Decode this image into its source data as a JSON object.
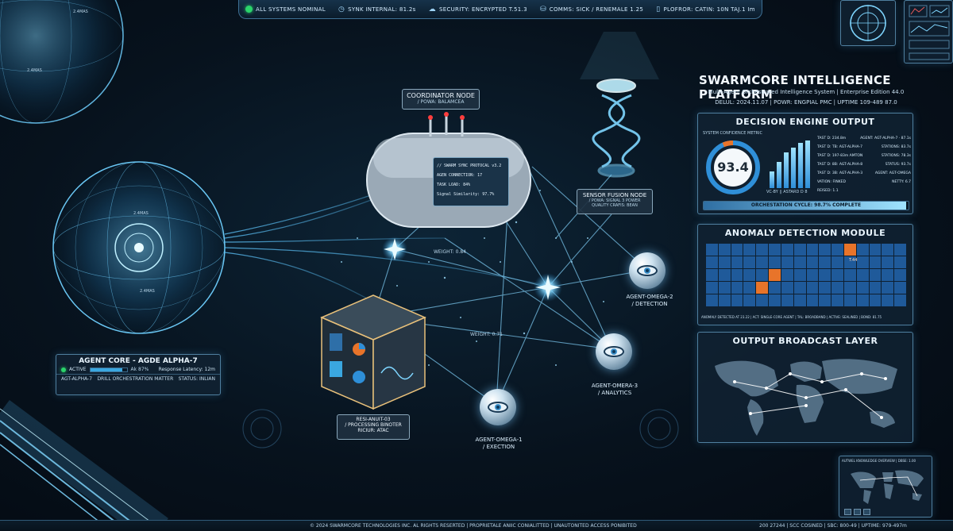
{
  "topbar": {
    "status": "ALL SYSTEMS NOMINAL",
    "sync": "SYNK INTERNAL: 81.2s",
    "security": "SECURITY: ENCRYPTED T.51.3",
    "comms": "COMMS: SICK / RENEMALE 1.25",
    "platform": "PLOFROR: CATIN: 10N TAJ.1 Im"
  },
  "platform": {
    "title": "SWARMCORE INTELLIGENCE PLATFORM",
    "subtitle": "Multi-Agent Orchestrated Intelligence System | Enterprise Edition 44.0",
    "meta": "DELUL: 2024.11.07 | POWR: ENGPIAL PMC | UPTIME 109-489 87.0"
  },
  "decision": {
    "title": "DECISION ENGINE OUTPUT",
    "gauge_caption": "SYSTEM CONFIDENCE METRIC",
    "gauge_value": "93.4",
    "gauge_fraction": 0.934,
    "bar_caption": "VC-BY  ||  ASTARD  D 8",
    "bars": [
      0.35,
      0.55,
      0.75,
      0.85,
      0.95,
      1.0
    ],
    "rows": [
      [
        "TAST D: 234.8m",
        "AGENT: AGT-ALPHA-7 · 87.1s"
      ],
      [
        "TAST D: TB: AGT-ALPHA-7",
        "STATIONS: 83.7s"
      ],
      [
        "TAST D: 197-83m   AMTON",
        "STATIONS: 78.3s"
      ],
      [
        "TAST D: 8B: AGT-ALPHA-8",
        "STATUS: 93.7s"
      ],
      [
        "TAST D: 3B: AGT-ALPHA-3",
        "AGENT: AGT-OMEGA"
      ],
      [
        "VATION: FINKED",
        "NETTY: 6.7"
      ],
      [
        "REISED: 1.1",
        ""
      ]
    ],
    "progress_label": "ORCHESTATION CYCLE: 98.7% COMPLETE",
    "progress": 0.987
  },
  "anomaly": {
    "title": "ANOMALY DETECTION MODULE",
    "flag_label": "T.44",
    "footer": "ANOMALY DETECTED AT 23.22  |  ACT: SINGLE-CORE AGENT  |  TAL: BROADBAND  |  ACTIVE: SEALINED  |  BOND: 81.75"
  },
  "broadcast": {
    "title": "OUTPUT BROADCAST LAYER"
  },
  "minimap": {
    "caption": "AUTWEL KNOWLEDGE OVERVIEW  |  DBSE: 1.00"
  },
  "coordinator": {
    "title": "COORDINATOR NODE",
    "sub": "/ POWA: BALAMCEA",
    "screen": [
      "// SWARM SYNC PROTOCAL v3.2",
      "AGEN CONNECTION: 17",
      "TASK LOAD: 84%",
      "Signal Similarity: 97.7%"
    ]
  },
  "sensor": {
    "title": "SENSOR FUSION NODE",
    "line1": "/ POWA: SIGNAL 3 POWER",
    "line2": "QUALITY CRAFIS: BEAN"
  },
  "agent_core": {
    "title": "AGENT CORE - AGDE ALPHA-7",
    "status": "ACTIVE",
    "load": "Ak 87%",
    "load_fraction": 0.87,
    "latency": "Response Latency: 12m",
    "id": "AGT-ALPHA-7",
    "role": "DRILL ORCHESTRATION MATTER",
    "status_line": "STATUS: INLIAN"
  },
  "cube": {
    "l1": "RESI-ANUIT-03",
    "l2": "/ PROCESSING BINOTER",
    "l3": "RICIUR: ATAC"
  },
  "weights": {
    "w1": "WEIGHT: 0.84",
    "w2": "WEIGHT: 0.71"
  },
  "agents": [
    {
      "name": "AGENT-OMEGA-2",
      "role": "/ DETECTION"
    },
    {
      "name": "AGENT-OMERA-3",
      "role": "/ ANALYTICS"
    },
    {
      "name": "AGENT-OMEGA-1",
      "role": "/ EXECTION"
    }
  ],
  "sphere_labels": [
    "2.4MAS",
    "2.4MAS",
    "2.4MAS",
    "2.4MAS"
  ],
  "footer": {
    "copyright": "© 2024 SWARMCORE TECHNOLOGIES INC.  AL RIGHTS RESERTED  |  PROPRIETALE ANIIC CONIALITTED  |  UNAUTONITED ACCESS PONIBITED",
    "right": "200  27244  |  SCC COSINED  |  SBC: 800-49  |  UPTIME: 979-497m"
  },
  "colors": {
    "accent": "#49b8f0",
    "gauge_ring": "#2f8fd8",
    "gauge_arc": "#e8742a",
    "heat_cell": "#1f5a9a",
    "heat_hot": "#e8742a",
    "status_green": "#2bd46b"
  }
}
